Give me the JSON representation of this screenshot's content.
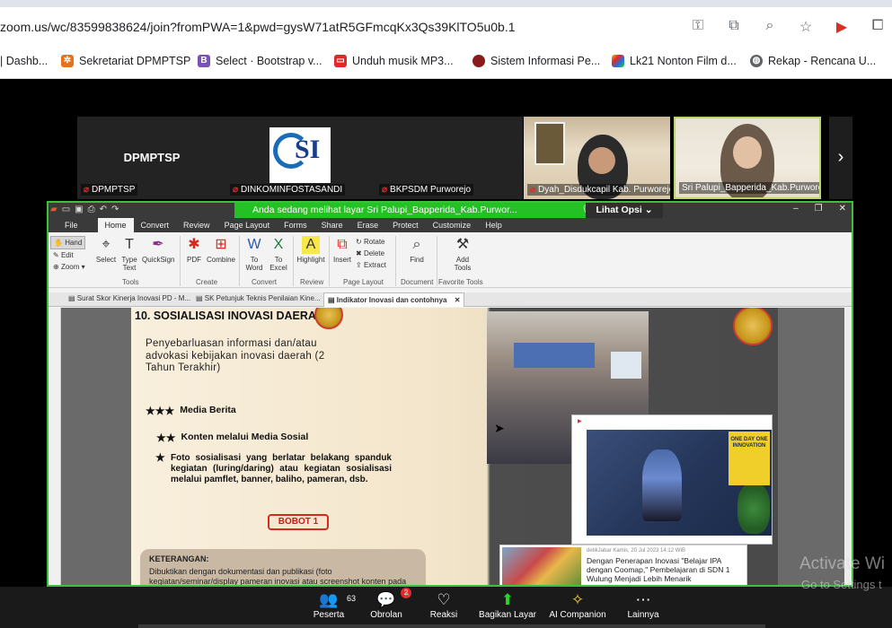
{
  "browser": {
    "url": "zoom.us/wc/83599838624/join?fromPWA=1&pwd=gysW71atR5GFmcqKx3Qs39KlTO5u0b.1",
    "bookmarks": [
      {
        "label": "| Dashb...",
        "icon": "dashboard-icon",
        "color": "#1a73e8"
      },
      {
        "label": "Sekretariat DPMPTSP",
        "icon": "settings-icon",
        "color": "#e8711a"
      },
      {
        "label": "Select · Bootstrap v...",
        "icon": "bootstrap-icon",
        "color": "#7952b3"
      },
      {
        "label": "Unduh musik MP3...",
        "icon": "music-icon",
        "color": "#e02828"
      },
      {
        "label": "Sistem Informasi Pe...",
        "icon": "gov-seal-icon",
        "color": "#8a1b1b"
      },
      {
        "label": "Lk21 Nonton Film d...",
        "icon": "pinwheel-icon",
        "color": "#e8b81a"
      },
      {
        "label": "Rekap - Rencana U...",
        "icon": "globe-icon",
        "color": "#5f6368"
      }
    ]
  },
  "zoom": {
    "participants": [
      {
        "name": "DPMPTSP",
        "center": "DPMPTSP"
      },
      {
        "name": "DINKOMINFOSTASANDI"
      },
      {
        "name": "BKPSDM Purworejo"
      },
      {
        "name": "Dyah_Disdukcapil Kab. Purworejo"
      },
      {
        "name": "Sri Palupi_Bapperida_Kab.Purworejo"
      }
    ],
    "osi_logo_text": "SI",
    "share_banner": "Anda sedang melihat layar  Sri Palupi_Bapperida_Kab.Purwor...",
    "view_options": "Lihat Opsi ⌄",
    "toolbar": [
      {
        "label": "Peserta",
        "count": "63"
      },
      {
        "label": "Obrolan",
        "badge": "2"
      },
      {
        "label": "Reaksi"
      },
      {
        "label": "Bagikan Layar"
      },
      {
        "label": "AI Companion"
      },
      {
        "label": "Lainnya"
      }
    ]
  },
  "pdf_app": {
    "ribbon_tabs": [
      "File",
      "Home",
      "Convert",
      "Review",
      "Page Layout",
      "Forms",
      "Share",
      "Erase",
      "Protect",
      "Customize",
      "Help"
    ],
    "small_tools": [
      "Hand",
      "Edit",
      "Zoom"
    ],
    "tools": [
      "Select",
      "Type Text",
      "QuickSign",
      "PDF",
      "Combine",
      "To Word",
      "To Excel",
      "Highlight",
      "Insert",
      "Rotate",
      "Delete",
      "Extract",
      "Find",
      "Add Tools"
    ],
    "groups": [
      "Tools",
      "Create",
      "Convert",
      "Review",
      "Page Layout",
      "Document",
      "Favorite Tools"
    ],
    "doc_tabs": [
      "Surat Skor Kinerja Inovasi PD - M...",
      "SK Petunjuk Teknis Penilaian Kine...",
      "Indikator Inovasi dan contohnya"
    ]
  },
  "slide": {
    "title": "10. SOSIALISASI INOVASI DAERAH",
    "description": "Penyebarluasan informasi dan/atau advokasi kebijakan inovasi daerah (2 Tahun Terakhir)",
    "criteria": [
      {
        "stars": "★★★",
        "text": "Media Berita"
      },
      {
        "stars": "★★",
        "text": "Konten melalui Media Sosial"
      },
      {
        "stars": "★",
        "text": "Foto sosialisasi yang berlatar belakang spanduk kegiatan (luring/daring) atau kegiatan sosialisasi melalui pamflet, banner, baliho, pameran, dsb."
      }
    ],
    "bobot": "BOBOT 1",
    "keterangan_title": "KETERANGAN:",
    "keterangan_text": "Dibuktikan dengan dokumentasi dan publikasi (foto kegiatan/seminar/display pameran inovasi atau screenshot konten pada",
    "yt_overlay": "ONE DAY ONE INNOVATION",
    "news_source": "detikJabar   Kamis, 20 Jul 2023 14:12 WIB",
    "news_headline": "Dengan Penerapan Inovasi \"Belajar IPA dengan Coomap,\" Pembelajaran di SDN 1 Wulung Menjadi Lebih Menarik"
  },
  "windows": {
    "activate_title": "Activate Wi",
    "activate_sub": "Go to Settings t"
  }
}
